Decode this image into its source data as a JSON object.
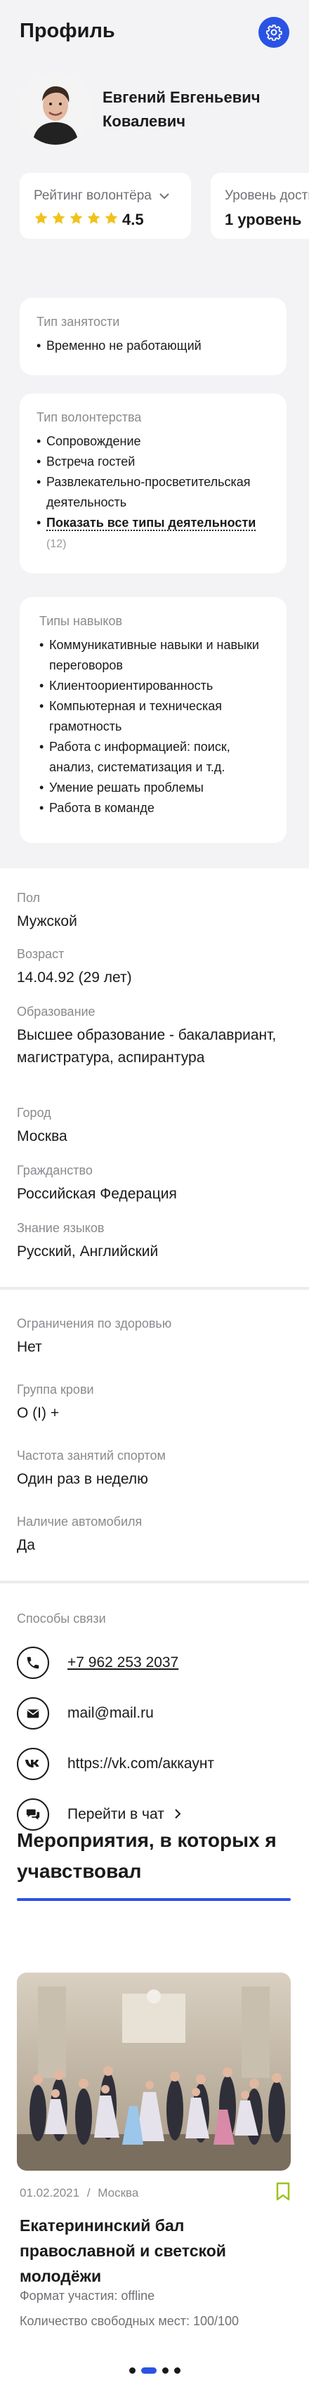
{
  "header": {
    "title": "Профиль"
  },
  "profile": {
    "full_name": "Евгений Евгеньевич Ковалевич",
    "rating": {
      "label": "Рейтинг волонтёра",
      "stars": 5,
      "value": "4.5"
    },
    "level": {
      "label": "Уровень достижений",
      "value": "1 уровень"
    }
  },
  "employment": {
    "title": "Тип занятости",
    "items": [
      "Временно не работающий"
    ]
  },
  "volunteering": {
    "title": "Тип волонтерства",
    "items": [
      "Сопровождение",
      "Встреча гостей",
      "Развлекательно-просветительская деятельность"
    ],
    "show_all": "Показать все типы деятельности",
    "show_all_count": "(12)"
  },
  "skills": {
    "title": "Типы навыков",
    "items": [
      "Коммуникативные навыки и навыки переговоров",
      "Клиентоориентированность",
      "Компьютерная и техническая грамотность",
      "Работа с информацией: поиск, анализ, систематизация и т.д.",
      "Умение решать проблемы",
      "Работа в команде"
    ]
  },
  "personal": {
    "gender": {
      "label": "Пол",
      "value": "Мужской"
    },
    "age": {
      "label": "Возраст",
      "value": "14.04.92 (29 лет)"
    },
    "education": {
      "label": "Образование",
      "value": "Высшее образование - бакалавриант, магистратура, аспирантура"
    },
    "city": {
      "label": "Город",
      "value": "Москва"
    },
    "citizenship": {
      "label": "Гражданство",
      "value": "Российская Федерация"
    },
    "languages": {
      "label": "Знание языков",
      "value": "Русский, Английский"
    }
  },
  "health": {
    "restrictions": {
      "label": "Ограничения по здоровью",
      "value": "Нет"
    },
    "blood": {
      "label": "Группа крови",
      "value": "O (I) +"
    },
    "sport": {
      "label": "Частота занятий спортом",
      "value": "Один раз в неделю"
    },
    "car": {
      "label": "Наличие автомобиля",
      "value": "Да"
    }
  },
  "contacts": {
    "title": "Способы связи",
    "phone": "+7 962 253 2037",
    "email": "mail@mail.ru",
    "vk": "https://vk.com/аккаунт",
    "chat": "Перейти в чат"
  },
  "events": {
    "title": "Мероприятия, в которых я учавствовал",
    "card": {
      "date": "01.02.2021",
      "separator": "/",
      "city": "Москва",
      "name": "Екатерининский бал православной и светской молодёжи",
      "format": "Формат участия: offline",
      "seats": "Количество свободных мест:  100/100"
    },
    "pager": {
      "pages": 4,
      "active": 2
    }
  },
  "colors": {
    "accent": "#2b53e3",
    "star": "#f2c21b",
    "bookmark": "#9bc31f"
  },
  "icons": [
    "gear-icon",
    "chevron-down-icon",
    "star-icon",
    "phone-icon",
    "mail-icon",
    "vk-icon",
    "chat-icon",
    "chevron-right-icon",
    "bookmark-icon"
  ]
}
